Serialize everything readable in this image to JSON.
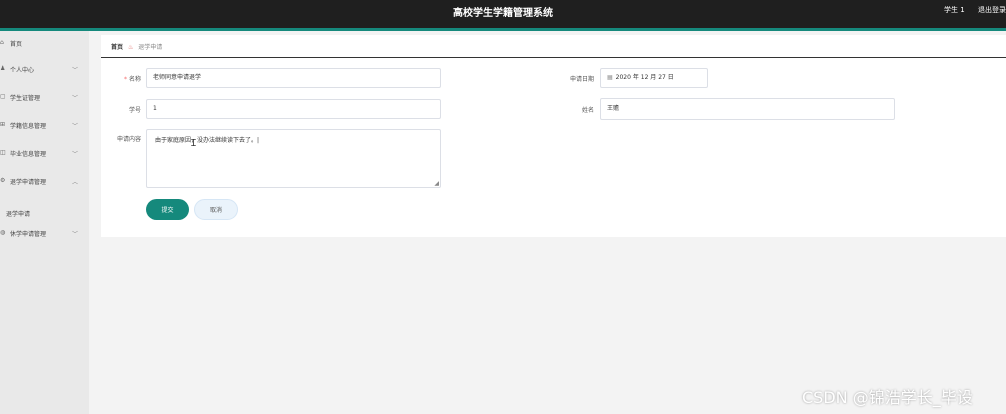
{
  "header": {
    "title": "高校学生学籍管理系统",
    "user": "学生 1",
    "logout": "退出登录"
  },
  "sidebar": {
    "items": [
      {
        "icon": "⌂",
        "label": "首页",
        "has_arrow": false
      },
      {
        "icon": "♟",
        "label": "个人中心",
        "has_arrow": true
      },
      {
        "icon": "▢",
        "label": "学生证管理",
        "has_arrow": true
      },
      {
        "icon": "⊞",
        "label": "学籍信息管理",
        "has_arrow": true
      },
      {
        "icon": "◫",
        "label": "毕业信息管理",
        "has_arrow": true
      },
      {
        "icon": "⚙",
        "label": "退学申请管理",
        "has_arrow": true,
        "expanded": true
      },
      {
        "icon": "◍",
        "label": "休学申请管理",
        "has_arrow": true
      }
    ],
    "subitem": "退学申请"
  },
  "breadcrumb": {
    "home": "首页",
    "current": "退学申请"
  },
  "form": {
    "name_label": "名称",
    "name_value": "老师同意申请退学",
    "date_label": "申请日期",
    "date_value": "2020 年 12 月 27 日",
    "student_no_label": "学号",
    "student_no_value": "1",
    "student_name_label": "姓名",
    "student_name_value": "王赡",
    "content_label": "申请内容",
    "content_value": "由于家庭原因，没办法继续读下去了。|",
    "submit": "提交",
    "cancel": "取消"
  },
  "watermark": "CSDN @锦浩学长_毕设"
}
